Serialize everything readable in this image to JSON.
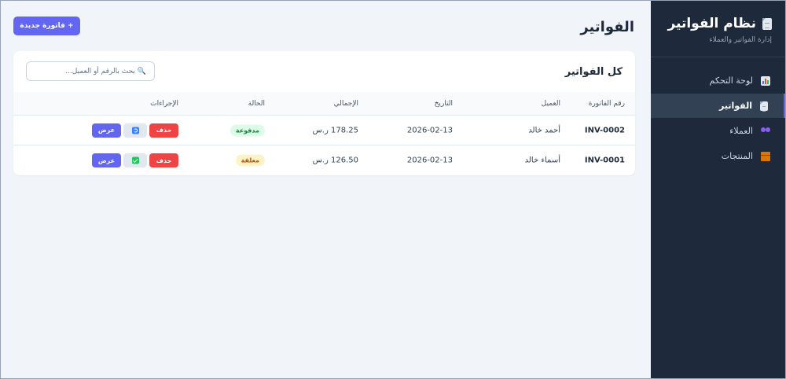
{
  "sidebar": {
    "brand_title": "نظام الفواتير",
    "brand_subtitle": "إدارة الفواتير والعملاء",
    "items": [
      {
        "label": "لوحة التحكم",
        "icon": "chart-icon",
        "active": false
      },
      {
        "label": "الفواتير",
        "icon": "document-icon",
        "active": true
      },
      {
        "label": "العملاء",
        "icon": "users-icon",
        "active": false
      },
      {
        "label": "المنتجات",
        "icon": "box-icon",
        "active": false
      }
    ]
  },
  "header": {
    "title": "الفواتير",
    "new_invoice_label": "+ فاتورة جديدة"
  },
  "invoices_card": {
    "title": "كل الفواتير",
    "search_placeholder": "🔍 بحث بالرقم أو العميل...",
    "columns": [
      "رقم الفاتورة",
      "العميل",
      "التاريخ",
      "الإجمالي",
      "الحالة",
      "الإجراءات"
    ],
    "rows": [
      {
        "number": "INV-0002",
        "client": "أحمد خالد",
        "date": "2026-02-13",
        "total": "178.25 ر.س",
        "status": "مدفوعة",
        "status_kind": "paid",
        "view_label": "عرض",
        "delete_label": "حذف",
        "mid_icon": "refresh-icon"
      },
      {
        "number": "INV-0001",
        "client": "أسماء خالد",
        "date": "2026-02-13",
        "total": "126.50 ر.س",
        "status": "معلقة",
        "status_kind": "pending",
        "view_label": "عرض",
        "delete_label": "حذف",
        "mid_icon": "check-icon"
      }
    ]
  },
  "colors": {
    "sidebar_bg": "#1e293b",
    "accent": "#6366f1",
    "danger": "#ef4444",
    "paid": "#15803d",
    "pending": "#b45309"
  }
}
